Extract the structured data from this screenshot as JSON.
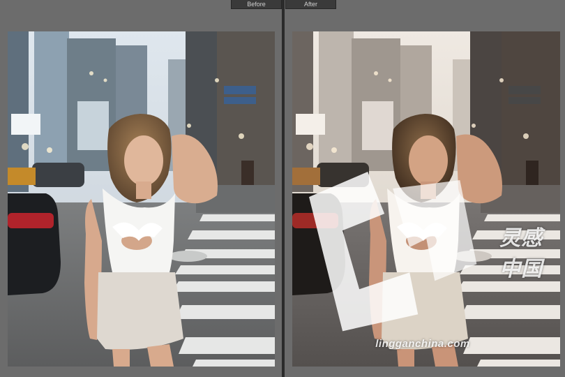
{
  "compare_view": {
    "before_label": "Before",
    "after_label": "After"
  },
  "watermark": {
    "chinese_text": "灵感中国",
    "url": "lingganchina.com",
    "logo_icon": "lg-logo-icon"
  },
  "colors": {
    "background": "#6c6c6c",
    "divider": "#2b2b2b",
    "tab_bg": "#3a3a3a",
    "before_sky": "#e9eef2",
    "after_sky": "#f1ece6"
  }
}
